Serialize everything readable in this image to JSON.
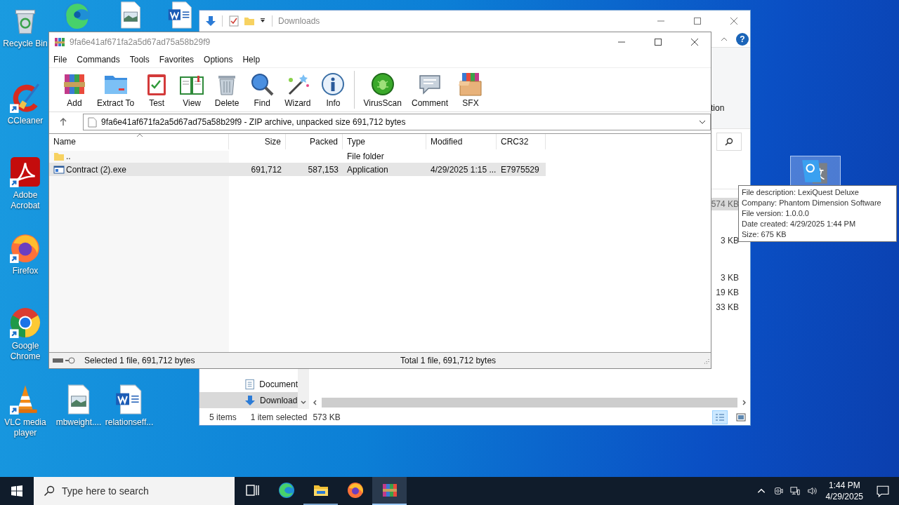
{
  "desktop": {
    "icons": [
      {
        "kind": "recycle_bin",
        "label": "Recycle Bin",
        "shortcut": false,
        "selected": false
      },
      {
        "kind": "edge",
        "shortcut": false,
        "selected": false
      },
      {
        "kind": "image_file",
        "shortcut": false,
        "selected": false
      },
      {
        "kind": "word_file",
        "shortcut": false,
        "selected": false
      },
      {
        "kind": "ccleaner",
        "label": "CCleaner",
        "shortcut": true,
        "selected": false
      },
      {
        "kind": "adobe",
        "label": "Adobe Acrobat",
        "shortcut": true,
        "selected": false
      },
      {
        "kind": "firefox",
        "label": "Firefox",
        "shortcut": true,
        "selected": false
      },
      {
        "kind": "chrome",
        "label": "Google Chrome",
        "shortcut": true,
        "selected": false
      },
      {
        "kind": "vlc",
        "label": "VLC media player",
        "shortcut": true,
        "selected": false
      },
      {
        "kind": "image_file",
        "label": "mbweight....",
        "shortcut": false,
        "selected": false
      },
      {
        "kind": "word_file",
        "label": "relationseff...",
        "shortcut": false,
        "selected": false
      },
      {
        "kind": "translate",
        "shortcut": false,
        "selected": true
      }
    ]
  },
  "explorer": {
    "title": "Downloads",
    "ribbon_text": "tion",
    "help": "?",
    "sizes": [
      {
        "size": "574 KB",
        "selected": true
      },
      {
        "size": "3 KB",
        "selected": false
      },
      {
        "size": "3 KB",
        "selected": false
      },
      {
        "size": "19 KB",
        "selected": false
      },
      {
        "size": "33 KB",
        "selected": false
      }
    ],
    "nav": [
      {
        "kind": "documents",
        "label": "Document",
        "selected": false
      },
      {
        "kind": "downloads",
        "label": "Download",
        "selected": true
      }
    ],
    "status": {
      "count": "5 items",
      "selection": "1 item selected",
      "size": "573 KB"
    },
    "views": [
      {
        "kind": "details",
        "selected": true
      },
      {
        "kind": "large_icons",
        "selected": false
      }
    ]
  },
  "winrar": {
    "title": "9fa6e41af671fa2a5d67ad75a58b29f9",
    "menu": [
      "File",
      "Commands",
      "Tools",
      "Favorites",
      "Options",
      "Help"
    ],
    "toolbar": [
      {
        "kind": "add",
        "label": "Add",
        "separator_before": false
      },
      {
        "kind": "extract",
        "label": "Extract To",
        "separator_before": false
      },
      {
        "kind": "test",
        "label": "Test",
        "separator_before": false
      },
      {
        "kind": "view",
        "label": "View",
        "separator_before": false
      },
      {
        "kind": "delete",
        "label": "Delete",
        "separator_before": false
      },
      {
        "kind": "find",
        "label": "Find",
        "separator_before": false
      },
      {
        "kind": "wizard",
        "label": "Wizard",
        "separator_before": false
      },
      {
        "kind": "info",
        "label": "Info",
        "separator_before": false
      },
      {
        "kind": "virusscan",
        "label": "VirusScan",
        "separator_before": true
      },
      {
        "kind": "comment",
        "label": "Comment",
        "separator_before": false
      },
      {
        "kind": "sfx",
        "label": "SFX",
        "separator_before": false
      }
    ],
    "address": "9fa6e41af671fa2a5d67ad75a58b29f9 - ZIP archive, unpacked size 691,712 bytes",
    "columns": [
      {
        "label": "Name",
        "sorted": true
      },
      {
        "label": "Size",
        "sorted": false
      },
      {
        "label": "Packed",
        "sorted": false
      },
      {
        "label": "Type",
        "sorted": false
      },
      {
        "label": "Modified",
        "sorted": false
      },
      {
        "label": "CRC32",
        "sorted": false
      }
    ],
    "rows": [
      {
        "kind": "folder",
        "name": "..",
        "type": "File folder",
        "selected": false
      },
      {
        "kind": "exe",
        "name": "Contract (2).exe",
        "size": "691,712",
        "packed": "587,153",
        "type": "Application",
        "modified": "4/29/2025 1:15 ...",
        "crc32": "E7975529",
        "selected": true
      }
    ],
    "status_left": "Selected 1 file, 691,712 bytes",
    "status_right": "Total 1 file, 691,712 bytes"
  },
  "tooltip": {
    "lines": [
      "File description: LexiQuest Deluxe",
      "Company: Phantom Dimension Software",
      "File version: 1.0.0.0",
      "Date created: 4/29/2025 1:44 PM",
      "Size: 675 KB"
    ]
  },
  "taskbar": {
    "search_placeholder": "Type here to search",
    "apps": [
      {
        "kind": "task_view",
        "running": false,
        "focused": false
      },
      {
        "kind": "edge",
        "running": false,
        "focused": false
      },
      {
        "kind": "explorer",
        "running": true,
        "focused": false
      },
      {
        "kind": "firefox",
        "running": false,
        "focused": false
      },
      {
        "kind": "winrar",
        "running": true,
        "focused": true
      }
    ],
    "time": "1:44 PM",
    "date": "4/29/2025"
  }
}
